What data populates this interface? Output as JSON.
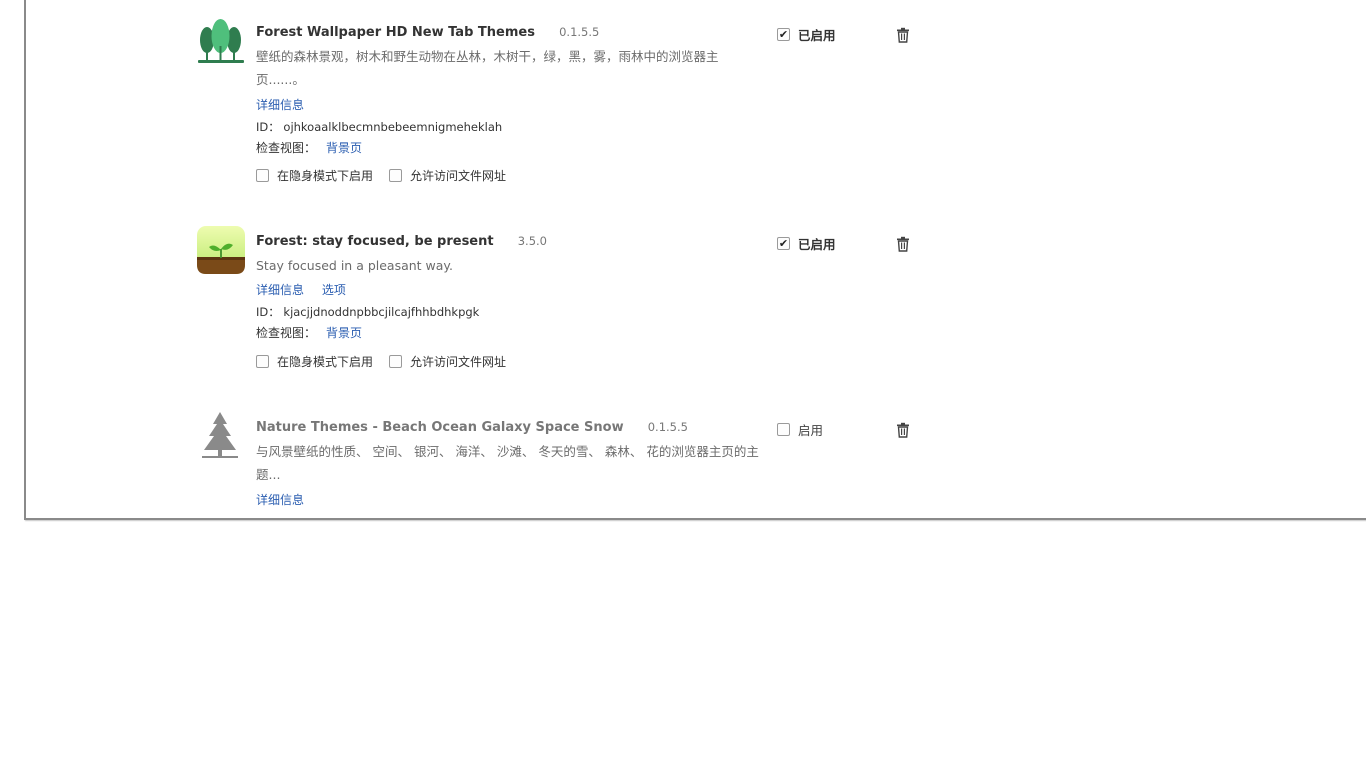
{
  "extensions": [
    {
      "name": "Forest Wallpaper HD New Tab Themes",
      "version": "0.1.5.5",
      "description": "壁纸的森林景观，树木和野生动物在丛林，木树干，绿，黑，雾，雨林中的浏览器主页......。",
      "links": [
        "详细信息"
      ],
      "id_label": "ID：",
      "id_value": "ojhkoaalklbecmnbebeemnigmeheklah",
      "views_label": "检查视图：",
      "views_link": "背景页",
      "option_incognito": "在隐身模式下启用",
      "option_files": "允许访问文件网址",
      "enabled": true,
      "enabled_label": "已启用"
    },
    {
      "name": "Forest: stay focused, be present",
      "version": "3.5.0",
      "description": "Stay focused in a pleasant way.",
      "links": [
        "详细信息",
        "选项"
      ],
      "id_label": "ID：",
      "id_value": "kjacjjdnoddnpbbcjilcajfhhbdhkpgk",
      "views_label": "检查视图：",
      "views_link": "背景页",
      "option_incognito": "在隐身模式下启用",
      "option_files": "允许访问文件网址",
      "enabled": true,
      "enabled_label": "已启用"
    },
    {
      "name": "Nature Themes - Beach Ocean Galaxy Space Snow",
      "version": "0.1.5.5",
      "description": "与风景壁纸的性质、 空间、 银河、 海洋、 沙滩、 冬天的雪、 森林、 花的浏览器主页的主题...",
      "links": [
        "详细信息"
      ],
      "enabled": false,
      "enabled_label": "启用"
    }
  ],
  "icons": {
    "ext0": "forest-trees-icon",
    "ext1": "sprout-icon",
    "ext2": "pine-tree-icon",
    "remove": "trash-icon",
    "check": "checkmark-icon"
  },
  "colors": {
    "link": "#2a5db0",
    "text": "#333333",
    "muted": "#6b6b6b",
    "forest_green": "#3e9e62",
    "sprout_bg": "#d4f28c",
    "soil": "#7a4a18"
  }
}
